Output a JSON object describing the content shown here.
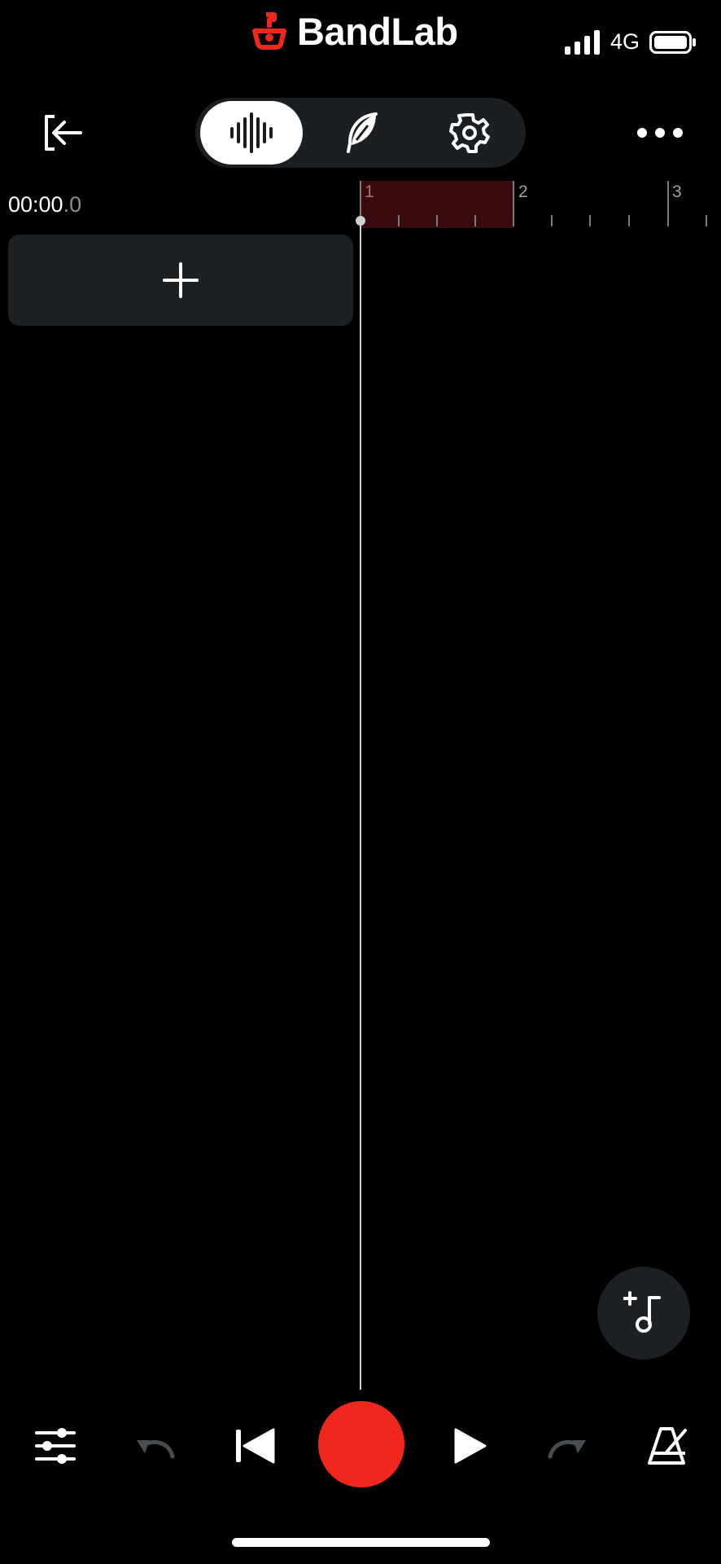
{
  "status_bar": {
    "brand": "BandLab",
    "network": "4G"
  },
  "toolbar": {
    "segments": [
      {
        "icon": "waveform-icon",
        "active": true
      },
      {
        "icon": "feather-icon",
        "active": false
      },
      {
        "icon": "gear-icon",
        "active": false
      }
    ]
  },
  "timeline": {
    "time_main": "00:00",
    "time_tenth": ".0",
    "bars": [
      "1",
      "2",
      "3"
    ]
  },
  "colors": {
    "accent_red": "#f0271c",
    "region_red": "#3a0b0e",
    "panel": "#1e2124"
  }
}
